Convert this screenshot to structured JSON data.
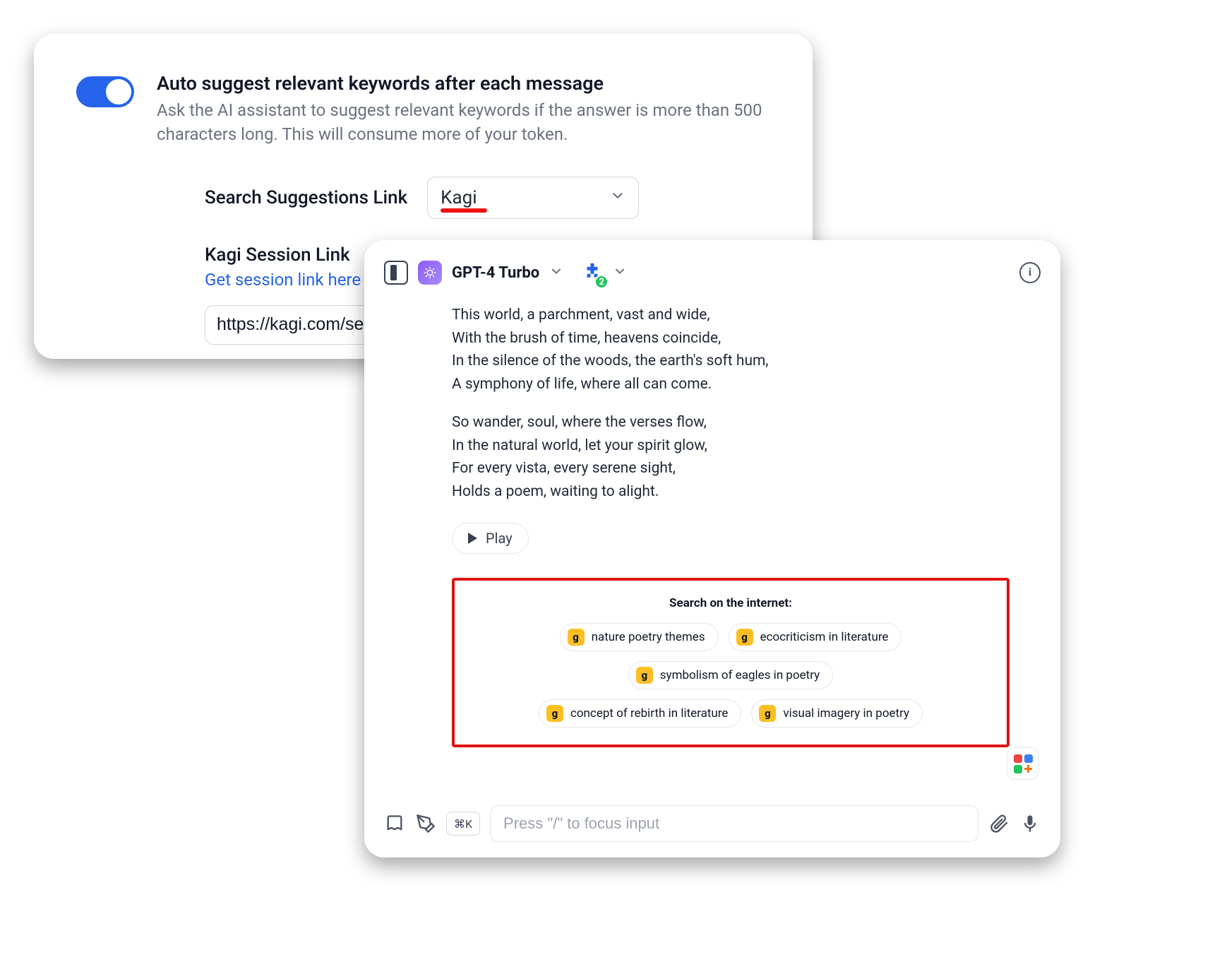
{
  "settings": {
    "title": "Auto suggest relevant keywords after each message",
    "description": "Ask the AI assistant to suggest relevant keywords if the answer is more than 500 characters long. This will consume more of your token.",
    "toggle_on": true,
    "suggestions_label": "Search Suggestions Link",
    "suggestions_value": "Kagi",
    "session_label": "Kagi Session Link",
    "session_link_text": "Get session link here",
    "session_input_value": "https://kagi.com/se"
  },
  "chat": {
    "model": "GPT-4 Turbo",
    "plugin_count": "2",
    "poem_lines_1": [
      "This world, a parchment, vast and wide,",
      "With the brush of time, heavens coincide,",
      "In the silence of the woods, the earth's soft hum,",
      "A symphony of life, where all can come."
    ],
    "poem_lines_2": [
      "So wander, soul, where the verses flow,",
      "In the natural world, let your spirit glow,",
      "For every vista, every serene sight,",
      "Holds a poem, waiting to alight."
    ],
    "play_label": "Play",
    "search_title": "Search on the internet:",
    "pills_row1": [
      "nature poetry themes",
      "ecocriticism in literature",
      "symbolism of eagles in poetry"
    ],
    "pills_row2": [
      "concept of rebirth in literature",
      "visual imagery in poetry"
    ],
    "shortcut": "⌘K",
    "input_placeholder": "Press \"/\" to focus input"
  }
}
